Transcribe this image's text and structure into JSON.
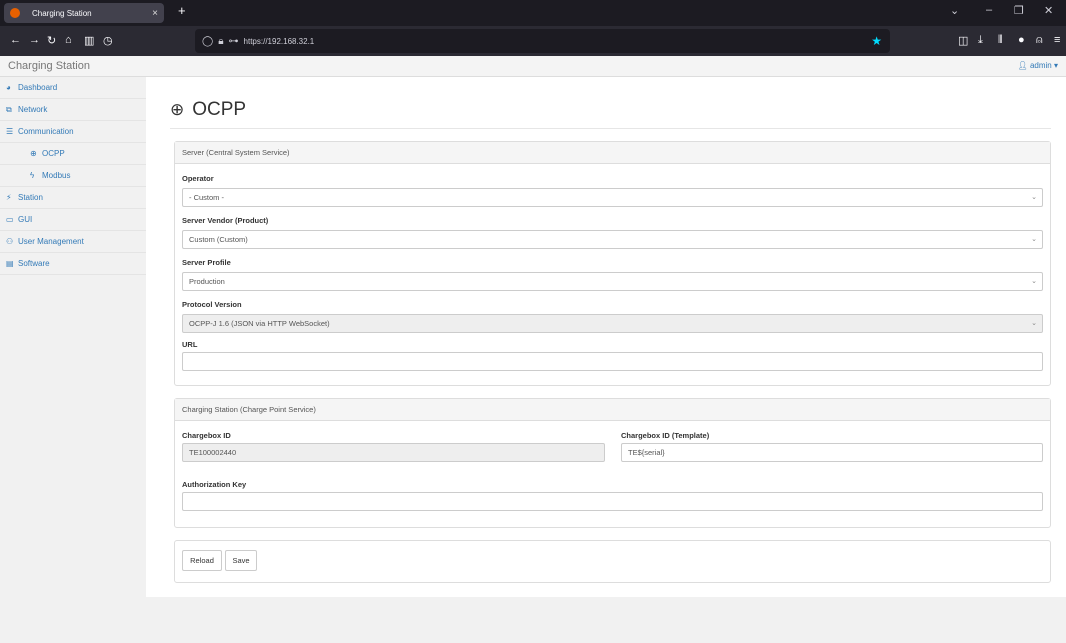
{
  "browser": {
    "tab_title": "Charging Station",
    "tab_close": "×",
    "new_tab": "+",
    "url": "https://192.168.32.1"
  },
  "app": {
    "brand": "Charging Station",
    "user": "admin"
  },
  "sidebar": {
    "items": [
      {
        "label": "Dashboard",
        "icon": "dashboard-icon"
      },
      {
        "label": "Network",
        "icon": "network-icon"
      },
      {
        "label": "Communication",
        "icon": "list-icon"
      },
      {
        "label": "OCPP",
        "icon": "globe-icon"
      },
      {
        "label": "Modbus",
        "icon": "flash-icon"
      },
      {
        "label": "Station",
        "icon": "station-icon"
      },
      {
        "label": "GUI",
        "icon": "monitor-icon"
      },
      {
        "label": "User Management",
        "icon": "users-icon"
      },
      {
        "label": "Software",
        "icon": "software-icon"
      }
    ]
  },
  "page": {
    "title": "OCPP"
  },
  "server_panel": {
    "heading": "Server (Central System Service)",
    "operator_label": "Operator",
    "operator_value": "- Custom -",
    "vendor_label": "Server Vendor (Product)",
    "vendor_value": "Custom (Custom)",
    "profile_label": "Server Profile",
    "profile_value": "Production",
    "protocol_label": "Protocol Version",
    "protocol_value": "OCPP-J 1.6 (JSON via HTTP WebSocket)",
    "url_label": "URL",
    "url_value": ""
  },
  "station_panel": {
    "heading": "Charging Station (Charge Point Service)",
    "chargebox_id_label": "Chargebox ID",
    "chargebox_id_value": "TE100002440",
    "chargebox_template_label": "Chargebox ID (Template)",
    "chargebox_template_value": "TE${serial}",
    "auth_key_label": "Authorization Key",
    "auth_key_value": ""
  },
  "actions": {
    "reload": "Reload",
    "save": "Save"
  }
}
